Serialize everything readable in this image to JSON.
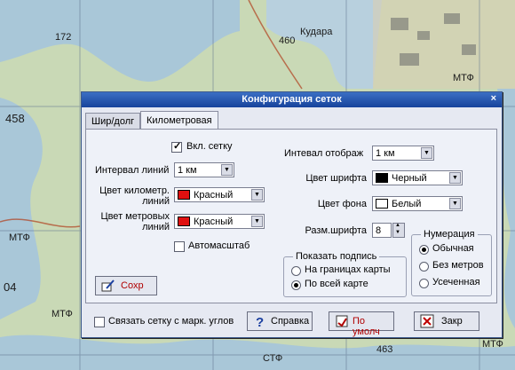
{
  "map": {
    "labels": [
      "Кудара",
      "460",
      "458",
      "МТФ",
      "МТФ",
      "МТФ",
      "МТФ",
      "463",
      "СТФ",
      "172",
      "04"
    ]
  },
  "dialog": {
    "title": "Конфигурация сеток",
    "close_glyph": "×",
    "tabs": [
      "Шир/долг",
      "Километровая"
    ],
    "left": {
      "show_grid_label": "Вкл. сетку",
      "line_interval_label": "Интервал линий",
      "line_interval_value": "1 км",
      "km_color_label": "Цвет километр. линий",
      "km_color_value": "Красный",
      "km_color_hex": "#e01010",
      "m_color_label": "Цвет метровых линий",
      "m_color_value": "Красный",
      "m_color_hex": "#e01010",
      "autoscale_label": "Автомасштаб",
      "save_label": "Сохр"
    },
    "right": {
      "display_interval_label": "Интевал отображ",
      "display_interval_value": "1 км",
      "font_color_label": "Цвет шрифта",
      "font_color_value": "Черный",
      "font_color_hex": "#000000",
      "bg_color_label": "Цвет фона",
      "bg_color_value": "Белый",
      "bg_color_hex": "#ffffff",
      "font_size_label": "Разм.шрифта",
      "font_size_value": "8",
      "numbering": {
        "caption": "Нумерация",
        "options": [
          "Обычная",
          "Без метров",
          "Усеченная"
        ],
        "selected": 0
      },
      "caption_group": {
        "caption": "Показать подпись",
        "options": [
          "На границах карты",
          "По всей карте"
        ],
        "selected": 1
      }
    },
    "bottom": {
      "link_label": "Связать сетку с марк. углов",
      "help_label": "Справка",
      "default_label": "По умолч",
      "close_label": "Закр"
    }
  }
}
